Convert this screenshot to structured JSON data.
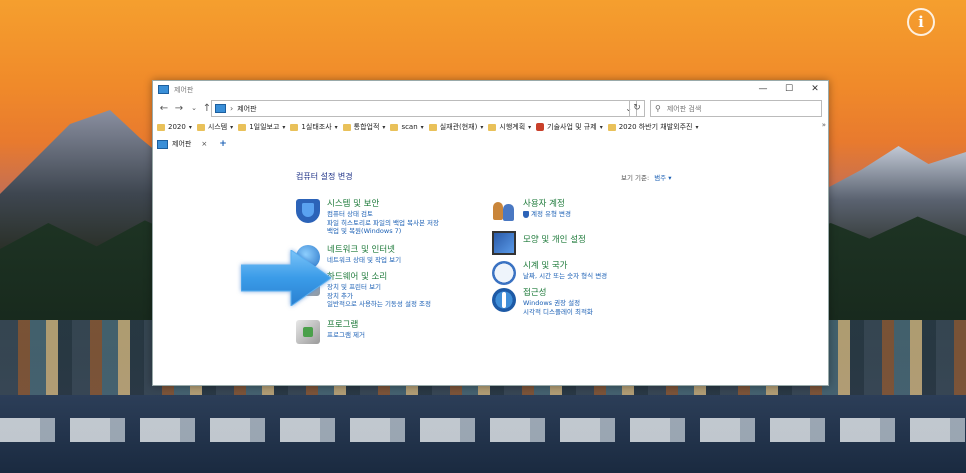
{
  "desktop": {
    "info_icon": "info-icon"
  },
  "window": {
    "title": "제어판",
    "controls": {
      "minimize": "—",
      "maximize": "☐",
      "close": "✕"
    }
  },
  "address": {
    "path": "제어판",
    "search_placeholder": "제어판 검색"
  },
  "favorites": [
    {
      "label": "2020",
      "type": "folder"
    },
    {
      "label": "시스템",
      "type": "folder"
    },
    {
      "label": "1일일보고",
      "type": "folder"
    },
    {
      "label": "1실태조사",
      "type": "folder"
    },
    {
      "label": "통합업적",
      "type": "folder"
    },
    {
      "label": "scan",
      "type": "folder"
    },
    {
      "label": "실재관(현재)",
      "type": "folder"
    },
    {
      "label": "시행계획",
      "type": "folder"
    },
    {
      "label": "기술사업 및 규제",
      "type": "site"
    },
    {
      "label": "2020 하반기 채발외주진",
      "type": "folder"
    }
  ],
  "favorites_more": "»",
  "tab": {
    "label": "제어판",
    "close": "×",
    "add": "+"
  },
  "page": {
    "title": "컴퓨터 설정 변경",
    "view_by_label": "보기 기준:",
    "view_by_value": "범주 ▾"
  },
  "categories_left": [
    {
      "heading": "시스템 및 보안",
      "icon": "shield-icon",
      "links": [
        "컴퓨터 상태 검토",
        "파일 히스토리로 파일의 백업 복사본 저장",
        "백업 및 복원(Windows 7)"
      ]
    },
    {
      "heading": "네트워크 및 인터넷",
      "icon": "network-globe-icon",
      "links": [
        "네트워크 상태 및 작업 보기"
      ]
    },
    {
      "heading": "하드웨어 및 소리",
      "icon": "hardware-sound-icon",
      "links": [
        "장치 및 프린터 보기",
        "장치 추가",
        "일반적으로 사용하는 기동성 설정 조정"
      ]
    },
    {
      "heading": "프로그램",
      "icon": "programs-icon",
      "links": [
        "프로그램 제거"
      ]
    }
  ],
  "categories_right": [
    {
      "heading": "사용자 계정",
      "icon": "user-accounts-icon",
      "links": [
        "계정 유형 변경"
      ]
    },
    {
      "heading": "모양 및 개인 설정",
      "icon": "appearance-icon",
      "links": []
    },
    {
      "heading": "시계 및 국가",
      "icon": "clock-region-icon",
      "links": [
        "날짜, 시간 또는 숫자 형식 변경"
      ]
    },
    {
      "heading": "접근성",
      "icon": "ease-of-access-icon",
      "links": [
        "Windows 권장 설정",
        "시각적 디스플레이 최적화"
      ]
    }
  ],
  "colors": {
    "heading_green": "#1e7a3a",
    "link_blue": "#1a5fb4",
    "title_navy": "#1e3287",
    "arrow_blue": "#3a9be8"
  }
}
